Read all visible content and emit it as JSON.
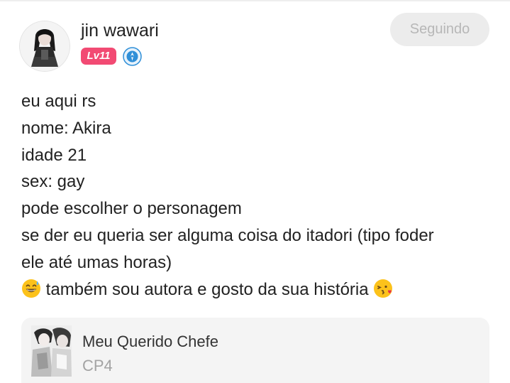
{
  "author": {
    "name": "jin wawari",
    "level_badge": "Lv11",
    "avatar_icon": "avatar-dark-haired-figure",
    "verified_icon": "blue-shield-badge-icon"
  },
  "follow_button": {
    "label": "Seguindo"
  },
  "post": {
    "lines": [
      "eu aqui rs",
      "nome: Akira",
      "idade 21",
      "sex: gay",
      "pode escolher o personagem",
      "se der eu queria ser alguma coisa do itadori (tipo foder",
      "ele até umas horas)"
    ],
    "last_line": {
      "text": "também sou autora e gosto da sua história",
      "leading_emoji": "grinning-face-with-sweat-emoji",
      "trailing_emoji": "face-blowing-kiss-emoji"
    }
  },
  "story_card": {
    "title": "Meu Querido Chefe",
    "chapter": "CP4",
    "cover_icon": "story-cover-illustration"
  },
  "colors": {
    "level_badge": "#f24a73",
    "verified": "#2f8fd8",
    "follow_button_bg": "#ececec",
    "follow_button_text": "#b7b7b7",
    "card_bg": "#f4f4f4",
    "chapter_text": "#a3a3a3"
  }
}
